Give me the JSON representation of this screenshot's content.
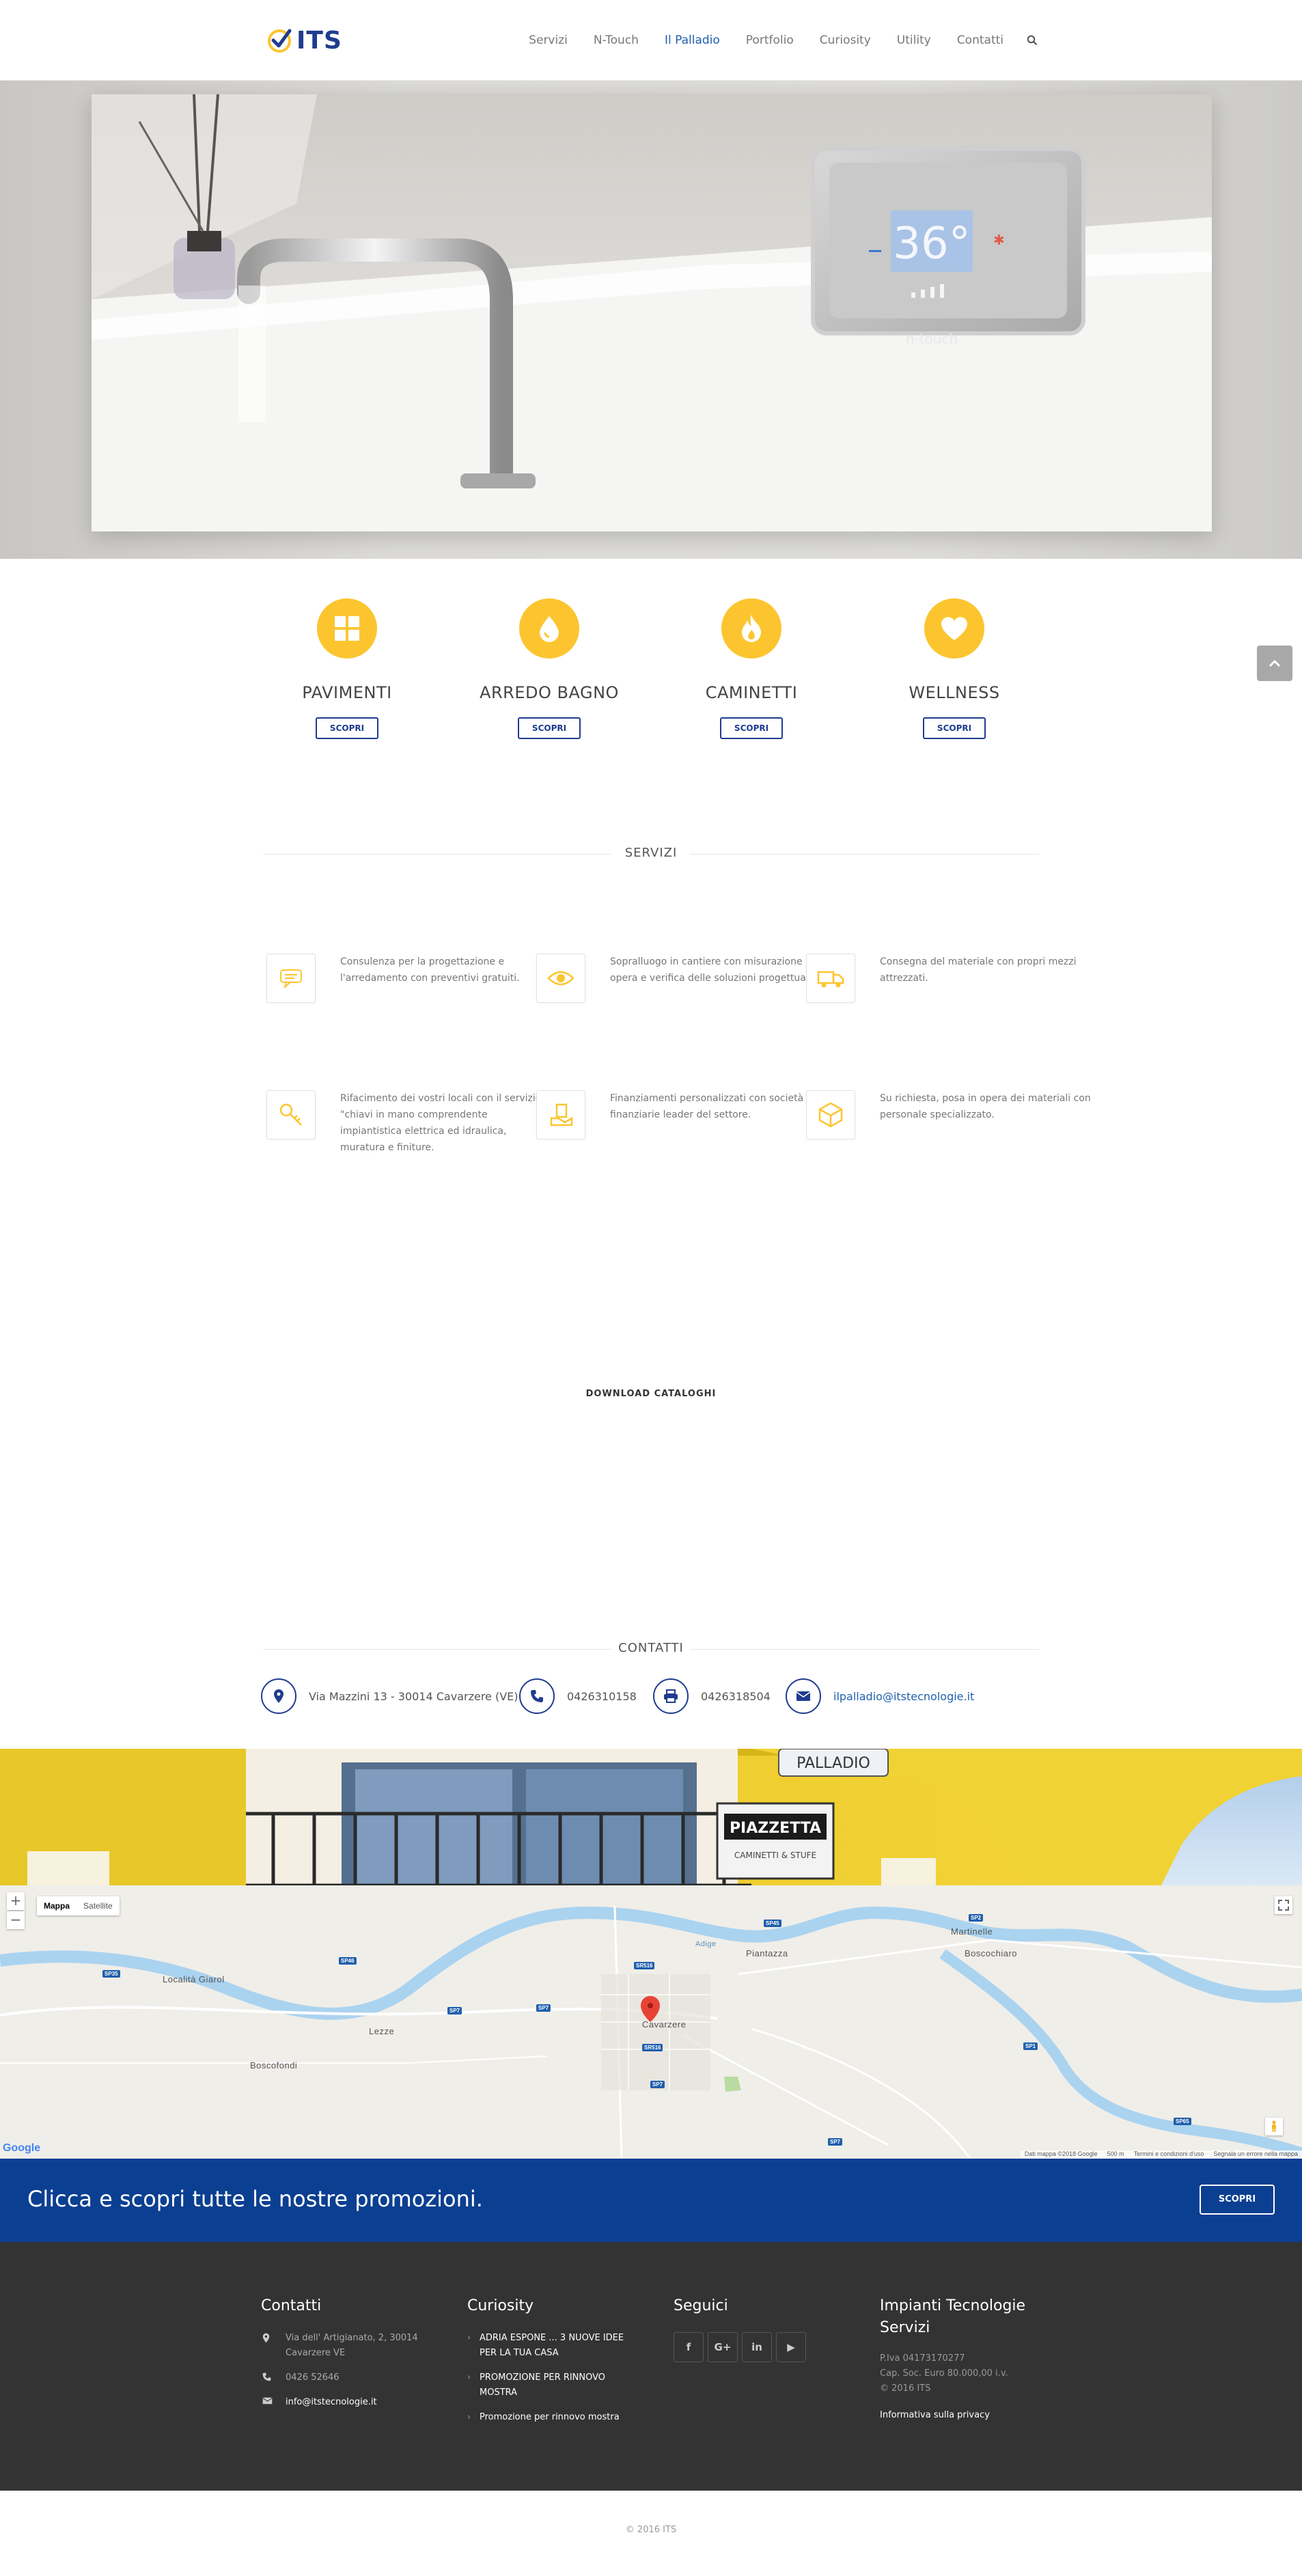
{
  "header": {
    "logo_text": "ITS",
    "nav": [
      "Servizi",
      "N-Touch",
      "Il Palladio",
      "Portfolio",
      "Curiosity",
      "Utility",
      "Contatti"
    ],
    "active_nav": "Il Palladio"
  },
  "hero": {
    "thermostat_temp": "36°",
    "thermostat_brand": "n-touch"
  },
  "features": [
    {
      "title": "PAVIMENTI",
      "button": "SCOPRI",
      "icon": "grid-icon"
    },
    {
      "title": "ARREDO BAGNO",
      "button": "SCOPRI",
      "icon": "drop-icon"
    },
    {
      "title": "CAMINETTI",
      "button": "SCOPRI",
      "icon": "flame-icon"
    },
    {
      "title": "WELLNESS",
      "button": "SCOPRI",
      "icon": "heart-icon"
    }
  ],
  "servizi": {
    "heading": "SERVIZI",
    "items": [
      {
        "text": "Consulenza per la progettazione e l'arredamento con preventivi gratuiti.",
        "icon": "chat-icon"
      },
      {
        "text": "Sopralluogo in cantiere con misurazione in opera e verifica delle soluzioni progettuali.",
        "icon": "eye-icon"
      },
      {
        "text": "Consegna del materiale con propri mezzi attrezzati.",
        "icon": "truck-icon"
      },
      {
        "text": "Rifacimento dei vostri locali con il servizio \"chiavi in mano comprendente impiantistica elettrica ed idraulica, muratura e finiture.",
        "icon": "key-icon"
      },
      {
        "text": "Finanziamenti personalizzati con società finanziarie leader del settore.",
        "icon": "money-hand-icon"
      },
      {
        "text": "Su richiesta, posa in opera dei materiali con personale specializzato.",
        "icon": "cube-icon"
      }
    ]
  },
  "download_label": "DOWNLOAD CATALOGHI",
  "contatti": {
    "heading": "CONTATTI",
    "address": "Via Mazzini 13 - 30014 Cavarzere (VE)",
    "phone": "0426310158",
    "fax": "0426318504",
    "email": "ilpalladio@itstecnologie.it"
  },
  "building": {
    "sign_brand": "PIAZZETTA",
    "sign_sub": "CAMINETTI & STUFE",
    "sign_top": "PALLADIO"
  },
  "map": {
    "toggle_map": "Mappa",
    "toggle_sat": "Satellite",
    "zoom_in": "+",
    "zoom_out": "−",
    "places": [
      "Località Giarol",
      "Lezze",
      "Boscofondi",
      "Piantazza",
      "Cavarzere",
      "Martinelle",
      "Boscochiaro"
    ],
    "river": "Adige",
    "google": "Google",
    "attribution": "Dati mappa ©2018 Google",
    "scale": "500 m",
    "terms": "Termini e condizioni d'uso",
    "report": "Segnala un errore nella mappa"
  },
  "promo": {
    "text": "Clicca e scopri tutte le nostre promozioni.",
    "button": "SCOPRI"
  },
  "footer": {
    "contatti": {
      "title": "Contatti",
      "address": "Via dell' Artigianato, 2, 30014 Cavarzere VE",
      "phone": "0426 52646",
      "email": "info@itstecnologie.it"
    },
    "curiosity": {
      "title": "Curiosity",
      "links": [
        "ADRIA ESPONE ... 3 NUOVE IDEE PER LA TUA CASA",
        "PROMOZIONE PER RINNOVO MOSTRA",
        "Promozione per rinnovo mostra"
      ]
    },
    "seguici": {
      "title": "Seguici",
      "social": [
        "f",
        "G+",
        "in",
        "▶"
      ]
    },
    "company": {
      "title": "Impianti Tecnologie Servizi",
      "piva": "P.Iva 04173170277",
      "capitale": "Cap. Soc. Euro 80.000,00 i.v.",
      "copy": "© 2016 ITS",
      "privacy": "Informativa sulla privacy"
    }
  },
  "copyright": "© 2016 ITS",
  "colors": {
    "accent_yellow": "#fcc530",
    "brand_blue": "#1f3c8f",
    "promo_blue": "#0b3f91",
    "footer_bg": "#333333"
  }
}
